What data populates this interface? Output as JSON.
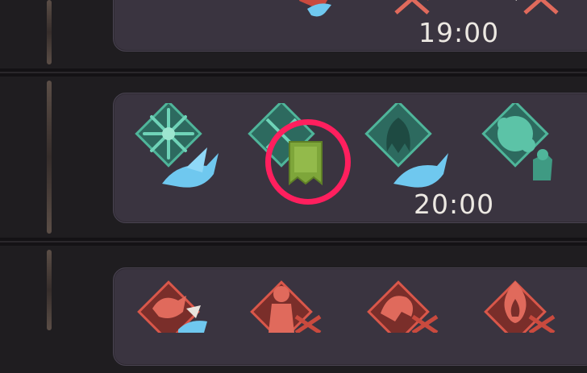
{
  "schedule": {
    "rows": [
      {
        "time": "19:00",
        "slots": [
          "red-crest-dove-icon",
          "red-crest-crossed-swords-icon",
          "red-crest-crossed-swords-icon"
        ]
      },
      {
        "time": "20:00",
        "slots": [
          "teal-snowflake-crest-dove-icon",
          "teal-crest-banner-icon",
          "teal-beast-crest-dove-icon",
          "teal-splatter-crest-knight-icon"
        ]
      },
      {
        "time": "",
        "slots": [
          "red-beast-crest-dove-icon",
          "red-monk-crest-crossed-swords-icon",
          "red-mane-crest-crossed-swords-icon",
          "red-flame-crest-crossed-swords-icon"
        ]
      }
    ],
    "highlighted_slot": {
      "row": 1,
      "slot": 1
    }
  },
  "colors": {
    "teal_crest": "#4fb59a",
    "red_crest": "#d9574a",
    "dove": "#6fc8ef",
    "banner": "#7ea63a",
    "highlight": "#ff1f5e",
    "card_bg": "#3a3440",
    "page_bg": "#1f1d20"
  }
}
